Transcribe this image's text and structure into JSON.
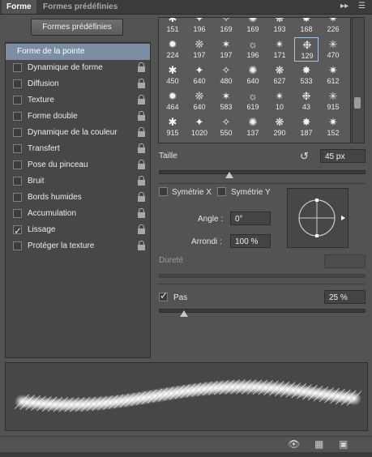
{
  "tabs": [
    {
      "label": "Forme"
    },
    {
      "label": "Formes prédéfinies"
    }
  ],
  "icons": {
    "panel_menu": "panel-menu-icon",
    "collapse": "double-chevron-right-icon",
    "reset": "reset-icon",
    "lock": "lock-icon"
  },
  "left": {
    "presets_button": "Formes prédéfinies",
    "items": [
      {
        "label": "Forme de la pointe",
        "checked": false,
        "selected": true,
        "lock": false
      },
      {
        "label": "Dynamique de forme",
        "checked": false,
        "lock": true
      },
      {
        "label": "Diffusion",
        "checked": false,
        "lock": true
      },
      {
        "label": "Texture",
        "checked": false,
        "lock": true
      },
      {
        "label": "Forme double",
        "checked": false,
        "lock": true
      },
      {
        "label": "Dynamique de la couleur",
        "checked": false,
        "lock": true
      },
      {
        "label": "Transfert",
        "checked": false,
        "lock": true
      },
      {
        "label": "Pose du pinceau",
        "checked": false,
        "lock": true
      },
      {
        "label": "Bruit",
        "checked": false,
        "lock": true
      },
      {
        "label": "Bords humides",
        "checked": false,
        "lock": true
      },
      {
        "label": "Accumulation",
        "checked": false,
        "lock": true
      },
      {
        "label": "Lissage",
        "checked": true,
        "lock": true
      },
      {
        "label": "Protéger la texture",
        "checked": false,
        "lock": true
      }
    ]
  },
  "brushes": {
    "rows": [
      [
        "151",
        "196",
        "169",
        "169",
        "193",
        "168",
        "226"
      ],
      [
        "224",
        "197",
        "197",
        "196",
        "171",
        "129",
        "470"
      ],
      [
        "450",
        "640",
        "480",
        "640",
        "627",
        "533",
        "612"
      ],
      [
        "464",
        "640",
        "583",
        "619",
        "10",
        "43",
        "915"
      ],
      [
        "915",
        "1020",
        "550",
        "137",
        "290",
        "187",
        "152"
      ]
    ],
    "selected": "129"
  },
  "size": {
    "label": "Taille",
    "value": "45 px",
    "fraction": 0.34
  },
  "flip_x": {
    "label": "Symétrie X",
    "checked": false
  },
  "flip_y": {
    "label": "Symétrie Y",
    "checked": false
  },
  "angle": {
    "label": "Angle :",
    "value": "0°"
  },
  "roundness": {
    "label": "Arrondi :",
    "value": "100 %"
  },
  "hardness": {
    "label": "Dureté",
    "value": ""
  },
  "spacing": {
    "label": "Pas",
    "checked": true,
    "value": "25 %",
    "fraction": 0.12
  }
}
